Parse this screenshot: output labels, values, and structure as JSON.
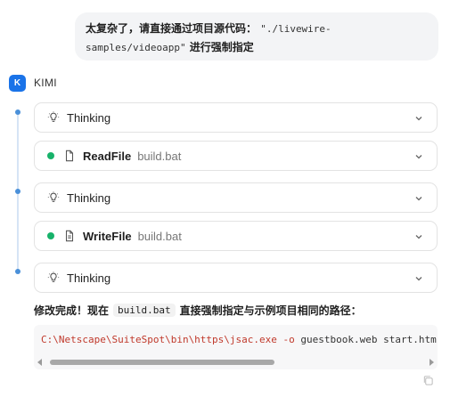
{
  "user_message": {
    "text_prefix": "太复杂了，请直接通过项目源代码：",
    "path": "\"./livewire-samples/videoapp\"",
    "text_suffix": "进行强制指定"
  },
  "assistant": {
    "avatar_letter": "K",
    "name": "KIMI"
  },
  "steps": [
    {
      "kind": "thinking",
      "label": "Thinking"
    },
    {
      "kind": "tool",
      "label": "ReadFile",
      "arg": "build.bat"
    },
    {
      "kind": "thinking",
      "label": "Thinking"
    },
    {
      "kind": "tool",
      "label": "WriteFile",
      "arg": "build.bat"
    },
    {
      "kind": "thinking",
      "label": "Thinking"
    }
  ],
  "result": {
    "prefix": "修改完成！现在",
    "code": "build.bat",
    "suffix": "直接强制指定与示例项目相同的路径："
  },
  "code_block": {
    "command": "C:\\Netscape\\SuiteSpot\\bin\\https\\jsac.exe",
    "flag": "-o",
    "rest": "guestbook.web start.htm index."
  },
  "colors": {
    "accent": "#1a73e8",
    "status_green": "#17b26a",
    "timeline": "#4a90d9"
  },
  "icons": [
    "lightbulb-icon",
    "file-icon",
    "file-text-icon",
    "chevron-down-icon",
    "copy-icon"
  ]
}
